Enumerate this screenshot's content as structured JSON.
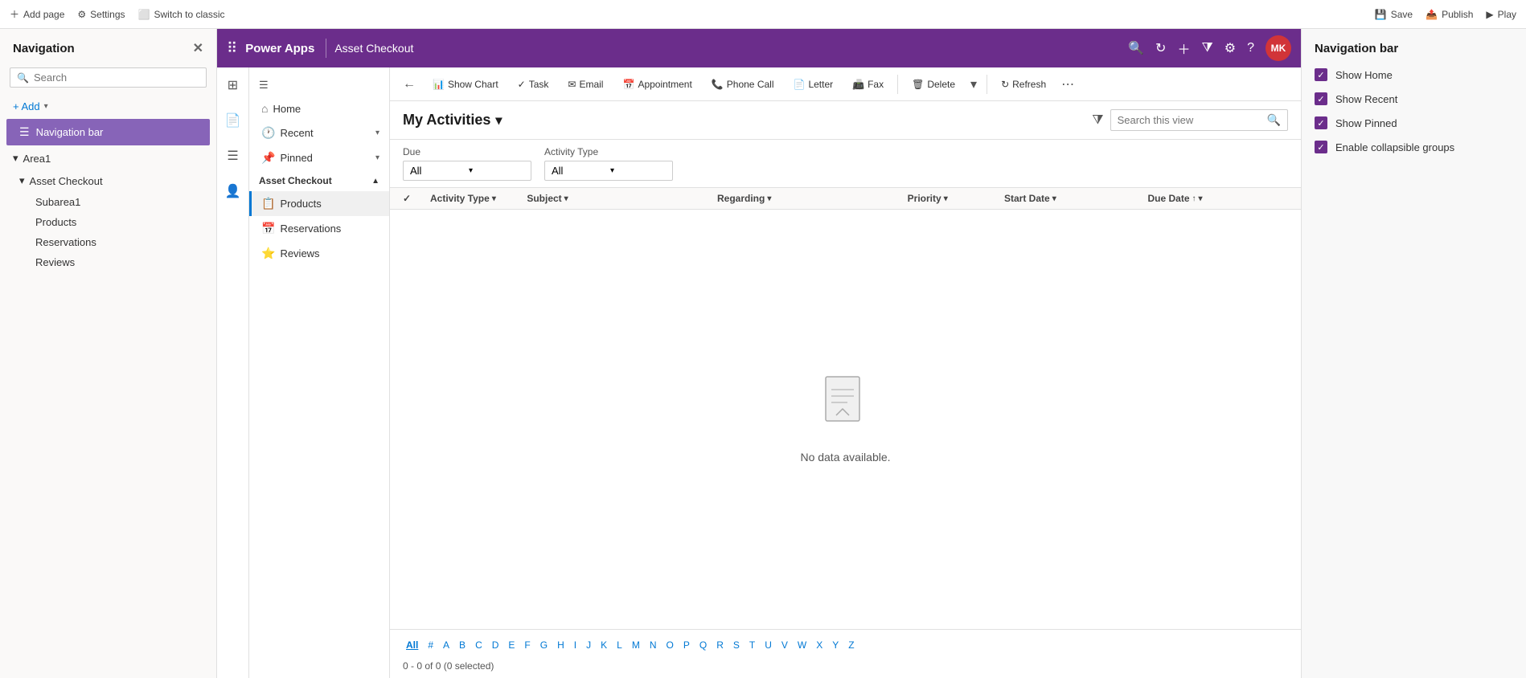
{
  "topBar": {
    "addPage": "Add page",
    "settings": "Settings",
    "switchToClassic": "Switch to classic",
    "save": "Save",
    "publish": "Publish",
    "play": "Play"
  },
  "leftNav": {
    "title": "Navigation",
    "searchPlaceholder": "Search",
    "addLabel": "+ Add",
    "navBarLabel": "Navigation bar",
    "area1Label": "Area1",
    "assetCheckoutLabel": "Asset Checkout",
    "subarea1Label": "Subarea1",
    "productsLabel": "Products",
    "reservationsLabel": "Reservations",
    "reviewsLabel": "Reviews"
  },
  "appHeader": {
    "appName": "Power Apps",
    "pageTitle": "Asset Checkout",
    "avatarText": "MK"
  },
  "navTree": {
    "homeLabel": "Home",
    "recentLabel": "Recent",
    "pinnedLabel": "Pinned",
    "assetCheckoutLabel": "Asset Checkout",
    "productsLabel": "Products",
    "reservationsLabel": "Reservations",
    "reviewsLabel": "Reviews"
  },
  "toolbar": {
    "showChart": "Show Chart",
    "task": "Task",
    "email": "Email",
    "appointment": "Appointment",
    "phoneCall": "Phone Call",
    "letter": "Letter",
    "fax": "Fax",
    "delete": "Delete",
    "refresh": "Refresh",
    "more": "..."
  },
  "viewHeader": {
    "title": "My Activities",
    "searchPlaceholder": "Search this view"
  },
  "filters": {
    "dueLabel": "Due",
    "activityTypeLabel": "Activity Type",
    "dueValue": "All",
    "activityTypeValue": "All"
  },
  "tableHeaders": {
    "activityType": "Activity Type",
    "subject": "Subject",
    "regarding": "Regarding",
    "priority": "Priority",
    "startDate": "Start Date",
    "dueDate": "Due Date"
  },
  "emptyState": {
    "message": "No data available."
  },
  "pagination": {
    "alphaItems": [
      "All",
      "#",
      "A",
      "B",
      "C",
      "D",
      "E",
      "F",
      "G",
      "H",
      "I",
      "J",
      "K",
      "L",
      "M",
      "N",
      "O",
      "P",
      "Q",
      "R",
      "S",
      "T",
      "U",
      "V",
      "W",
      "X",
      "Y",
      "Z"
    ],
    "activeAlpha": "All",
    "pageInfo": "0 - 0 of 0 (0 selected)"
  },
  "rightPanel": {
    "title": "Navigation bar",
    "options": [
      {
        "label": "Show Home",
        "checked": true
      },
      {
        "label": "Show Recent",
        "checked": true
      },
      {
        "label": "Show Pinned",
        "checked": true
      },
      {
        "label": "Enable collapsible groups",
        "checked": true
      }
    ]
  }
}
